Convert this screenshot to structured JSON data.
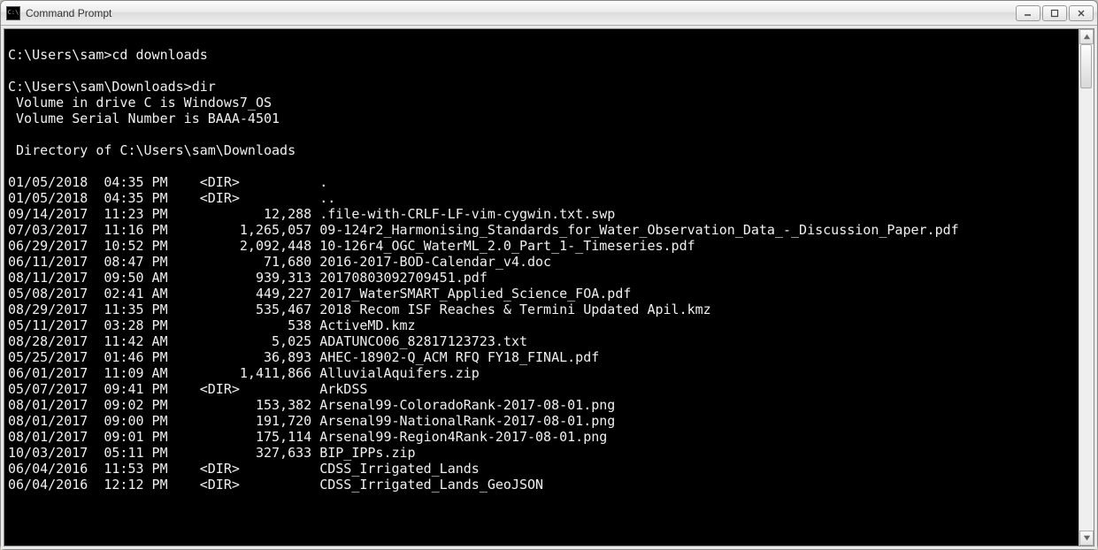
{
  "window": {
    "title": "Command Prompt"
  },
  "prompt1": {
    "path": "C:\\Users\\sam>",
    "cmd": "cd downloads"
  },
  "prompt2": {
    "path": "C:\\Users\\sam\\Downloads>",
    "cmd": "dir"
  },
  "vol": {
    "line1": " Volume in drive C is Windows7_OS",
    "line2": " Volume Serial Number is BAAA-4501",
    "dirof": " Directory of C:\\Users\\sam\\Downloads"
  },
  "entries": [
    {
      "date": "01/05/2018",
      "time": "04:35 PM",
      "dir": "<DIR>",
      "size": "",
      "name": "."
    },
    {
      "date": "01/05/2018",
      "time": "04:35 PM",
      "dir": "<DIR>",
      "size": "",
      "name": ".."
    },
    {
      "date": "09/14/2017",
      "time": "11:23 PM",
      "dir": "",
      "size": "12,288",
      "name": ".file-with-CRLF-LF-vim-cygwin.txt.swp"
    },
    {
      "date": "07/03/2017",
      "time": "11:16 PM",
      "dir": "",
      "size": "1,265,057",
      "name": "09-124r2_Harmonising_Standards_for_Water_Observation_Data_-_Discussion_Paper.pdf"
    },
    {
      "date": "06/29/2017",
      "time": "10:52 PM",
      "dir": "",
      "size": "2,092,448",
      "name": "10-126r4_OGC_WaterML_2.0_Part_1-_Timeseries.pdf"
    },
    {
      "date": "06/11/2017",
      "time": "08:47 PM",
      "dir": "",
      "size": "71,680",
      "name": "2016-2017-BOD-Calendar_v4.doc"
    },
    {
      "date": "08/11/2017",
      "time": "09:50 AM",
      "dir": "",
      "size": "939,313",
      "name": "20170803092709451.pdf"
    },
    {
      "date": "05/08/2017",
      "time": "02:41 AM",
      "dir": "",
      "size": "449,227",
      "name": "2017_WaterSMART_Applied_Science_FOA.pdf"
    },
    {
      "date": "08/29/2017",
      "time": "11:35 PM",
      "dir": "",
      "size": "535,467",
      "name": "2018 Recom ISF Reaches & Termini Updated Apil.kmz"
    },
    {
      "date": "05/11/2017",
      "time": "03:28 PM",
      "dir": "",
      "size": "538",
      "name": "ActiveMD.kmz"
    },
    {
      "date": "08/28/2017",
      "time": "11:42 AM",
      "dir": "",
      "size": "5,025",
      "name": "ADATUNCO06_82817123723.txt"
    },
    {
      "date": "05/25/2017",
      "time": "01:46 PM",
      "dir": "",
      "size": "36,893",
      "name": "AHEC-18902-Q_ACM RFQ FY18_FINAL.pdf"
    },
    {
      "date": "06/01/2017",
      "time": "11:09 AM",
      "dir": "",
      "size": "1,411,866",
      "name": "AlluvialAquifers.zip"
    },
    {
      "date": "05/07/2017",
      "time": "09:41 PM",
      "dir": "<DIR>",
      "size": "",
      "name": "ArkDSS"
    },
    {
      "date": "08/01/2017",
      "time": "09:02 PM",
      "dir": "",
      "size": "153,382",
      "name": "Arsenal99-ColoradoRank-2017-08-01.png"
    },
    {
      "date": "08/01/2017",
      "time": "09:00 PM",
      "dir": "",
      "size": "191,720",
      "name": "Arsenal99-NationalRank-2017-08-01.png"
    },
    {
      "date": "08/01/2017",
      "time": "09:01 PM",
      "dir": "",
      "size": "175,114",
      "name": "Arsenal99-Region4Rank-2017-08-01.png"
    },
    {
      "date": "10/03/2017",
      "time": "05:11 PM",
      "dir": "",
      "size": "327,633",
      "name": "BIP_IPPs.zip"
    },
    {
      "date": "06/04/2016",
      "time": "11:53 PM",
      "dir": "<DIR>",
      "size": "",
      "name": "CDSS_Irrigated_Lands"
    },
    {
      "date": "06/04/2016",
      "time": "12:12 PM",
      "dir": "<DIR>",
      "size": "",
      "name": "CDSS_Irrigated_Lands_GeoJSON"
    }
  ]
}
